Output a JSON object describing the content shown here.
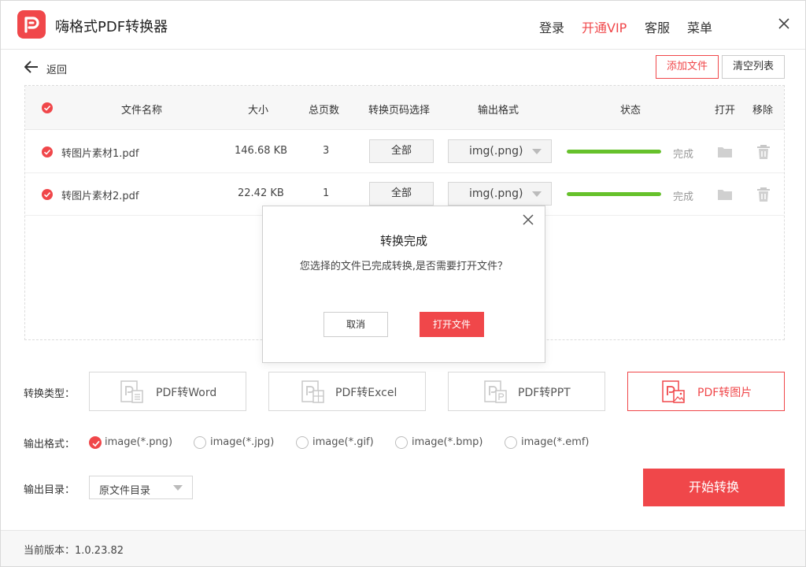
{
  "app": {
    "title": "嗨格式PDF转换器"
  },
  "topnav": {
    "login": "登录",
    "vip": "开通VIP",
    "service": "客服",
    "menu": "菜单"
  },
  "toolbar": {
    "back": "返回",
    "add_file": "添加文件",
    "clear_list": "清空列表"
  },
  "table": {
    "headers": {
      "name": "文件名称",
      "size": "大小",
      "pages": "总页数",
      "page_select": "转换页码选择",
      "format": "输出格式",
      "status": "状态",
      "open": "打开",
      "remove": "移除"
    },
    "rows": [
      {
        "name": "转图片素材1.pdf",
        "size": "146.68 KB",
        "pages": "3",
        "page_select": "全部",
        "format": "img(.png)",
        "progress": 1.0,
        "status": "完成"
      },
      {
        "name": "转图片素材2.pdf",
        "size": "22.42 KB",
        "pages": "1",
        "page_select": "全部",
        "format": "img(.png)",
        "progress": 1.0,
        "status": "完成"
      }
    ]
  },
  "dialog": {
    "title": "转换完成",
    "message": "您选择的文件已完成转换,是否需要打开文件？",
    "cancel": "取消",
    "open": "打开文件"
  },
  "conversion": {
    "label": "转换类型：",
    "types": [
      {
        "label": "PDF转Word",
        "icon": "pdf-to-word-icon",
        "active": false
      },
      {
        "label": "PDF转Excel",
        "icon": "pdf-to-excel-icon",
        "active": false
      },
      {
        "label": "PDF转PPT",
        "icon": "pdf-to-ppt-icon",
        "active": false
      },
      {
        "label": "PDF转图片",
        "icon": "pdf-to-image-icon",
        "active": true
      }
    ]
  },
  "output_format": {
    "label": "输出格式：",
    "options": [
      "image(*.png)",
      "image(*.jpg)",
      "image(*.gif)",
      "image(*.bmp)",
      "image(*.emf)"
    ],
    "selected": 0
  },
  "output_dir": {
    "label": "输出目录：",
    "value": "原文件目录"
  },
  "start_button": "开始转换",
  "footer": {
    "version": "当前版本：1.0.23.82"
  },
  "colors": {
    "accent": "#f0474a",
    "progress": "#66c12b"
  }
}
